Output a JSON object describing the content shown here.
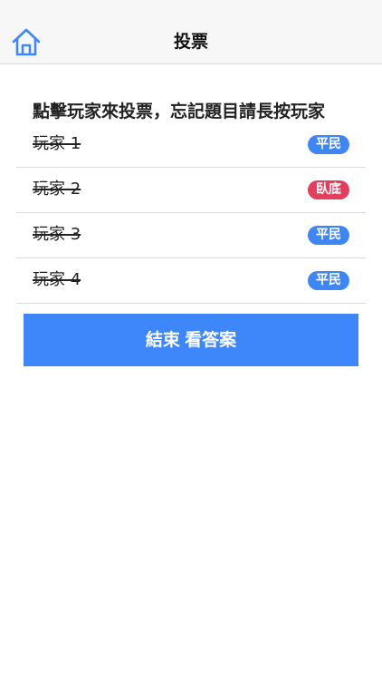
{
  "navbar": {
    "title": "投票",
    "home_icon": "home-icon"
  },
  "instruction": "點擊玩家來投票，忘記題目請長按玩家",
  "players": [
    {
      "name": "玩家 1",
      "role": "平民",
      "role_type": "civilian",
      "eliminated": true
    },
    {
      "name": "玩家 2",
      "role": "臥底",
      "role_type": "spy",
      "eliminated": true
    },
    {
      "name": "玩家 3",
      "role": "平民",
      "role_type": "civilian",
      "eliminated": true
    },
    {
      "name": "玩家 4",
      "role": "平民",
      "role_type": "civilian",
      "eliminated": true
    }
  ],
  "end_button": "結束 看答案",
  "colors": {
    "accent": "#3e87fb",
    "civilian_badge": "#3f86f5",
    "spy_badge": "#e43e5c",
    "navbar_bg": "#f7f7f7"
  }
}
